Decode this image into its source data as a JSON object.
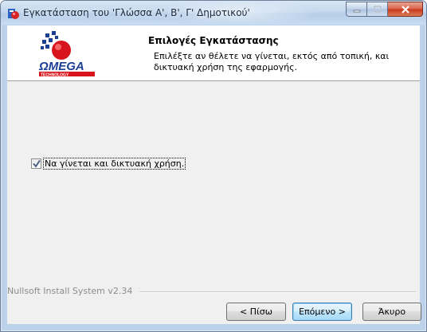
{
  "window": {
    "title": "Εγκατάσταση του 'Γλώσσα Α', Β', Γ' Δημοτικού'"
  },
  "header": {
    "title": "Επιλογές Εγκατάστασης",
    "subtitle": "Επιλέξτε αν θέλετε να γίνεται, εκτός από τοπική, και δικτυακή χρήση της εφαρμογής.",
    "logo_text": "ΩMEGA",
    "logo_subtext": "TECHNOLOGY"
  },
  "options": {
    "network_use": {
      "label": "Να γίνεται και δικτυακή χρήση.",
      "checked": true
    }
  },
  "footer": {
    "branding": "Nullsoft Install System v2.34",
    "back_label": "< Πίσω",
    "next_label": "Επόμενο >",
    "cancel_label": "Άκυρο"
  },
  "colors": {
    "frame": "#bcd2ea",
    "logo_red": "#d8141c",
    "logo_blue": "#1c3f94"
  },
  "icons": {
    "app": "installer-icon",
    "minimize": "minimize-icon",
    "maximize": "maximize-icon",
    "close": "close-icon",
    "check": "checkmark-icon"
  }
}
